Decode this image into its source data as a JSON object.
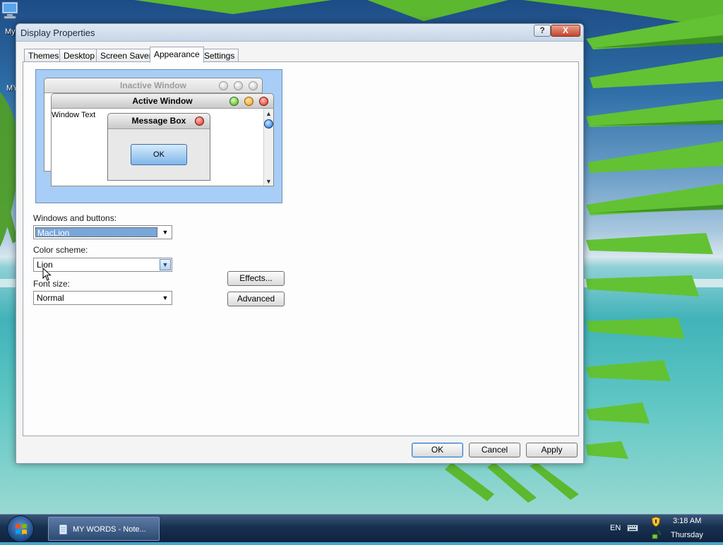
{
  "desktop": {
    "icon_label_1": "My",
    "icon_label_2": "MY"
  },
  "dialog": {
    "title": "Display Properties",
    "help_button": "?",
    "close_button": "X",
    "tabs": [
      {
        "label": "Themes",
        "active": false
      },
      {
        "label": "Desktop",
        "active": false
      },
      {
        "label": "Screen Saver",
        "active": false
      },
      {
        "label": "Appearance",
        "active": true
      },
      {
        "label": "Settings",
        "active": false
      }
    ]
  },
  "preview": {
    "inactive_title": "Inactive Window",
    "active_title": "Active Window",
    "window_text": "Window Text",
    "message_title": "Message Box",
    "message_ok": "OK"
  },
  "appearance": {
    "windows_buttons": {
      "label": "Windows and buttons:",
      "value": "MacLion"
    },
    "color_scheme": {
      "label": "Color scheme:",
      "value": "Lion"
    },
    "font_size": {
      "label": "Font size:",
      "value": "Normal"
    },
    "effects_button": "Effects...",
    "advanced_button": "Advanced"
  },
  "footer": {
    "ok": "OK",
    "cancel": "Cancel",
    "apply": "Apply"
  },
  "taskbar": {
    "task_item": "MY WORDS - Note...",
    "language": "EN",
    "time": "3:18 AM",
    "day": "Thursday"
  },
  "colors": {
    "accent": "#3b78c2",
    "preview_background": "#a8cdf6",
    "selection": "#7aa7d8"
  },
  "icons": [
    "computer-icon",
    "start-orb-icon",
    "notepad-icon",
    "keyboard-icon",
    "security-shield-icon",
    "network-icon",
    "mouse-cursor-icon"
  ]
}
